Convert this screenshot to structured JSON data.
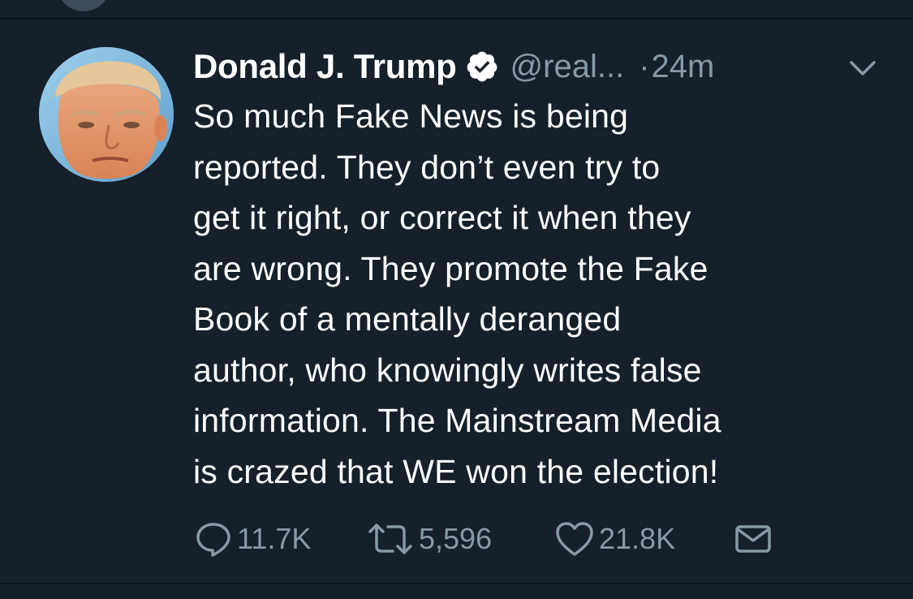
{
  "tweet": {
    "author": {
      "display_name": "Donald J. Trump",
      "handle": "@real...",
      "avatar_icon": "profile-photo",
      "verified_icon": "verified-badge-icon"
    },
    "separator": "·",
    "timestamp": "24m",
    "text_lines": [
      "So much Fake News is being",
      "reported. They don’t even try to",
      "get it right, or correct it when they",
      "are wrong. They promote the Fake",
      "Book of a mentally deranged",
      "author, who knowingly writes false",
      "information. The Mainstream Media",
      "is crazed that WE won the election!"
    ],
    "stats": {
      "replies": "11.7K",
      "retweets": "5,596",
      "likes": "21.8K"
    }
  },
  "icons": {
    "reply": "speech-bubble-icon",
    "retweet": "retweet-arrows-icon",
    "like": "heart-outline-icon",
    "dm": "envelope-icon",
    "menu": "chevron-down-icon"
  },
  "colors": {
    "background": "#15202b",
    "primary_text": "#ffffff",
    "secondary_text": "#8899a6",
    "divider": "#0d1218"
  }
}
